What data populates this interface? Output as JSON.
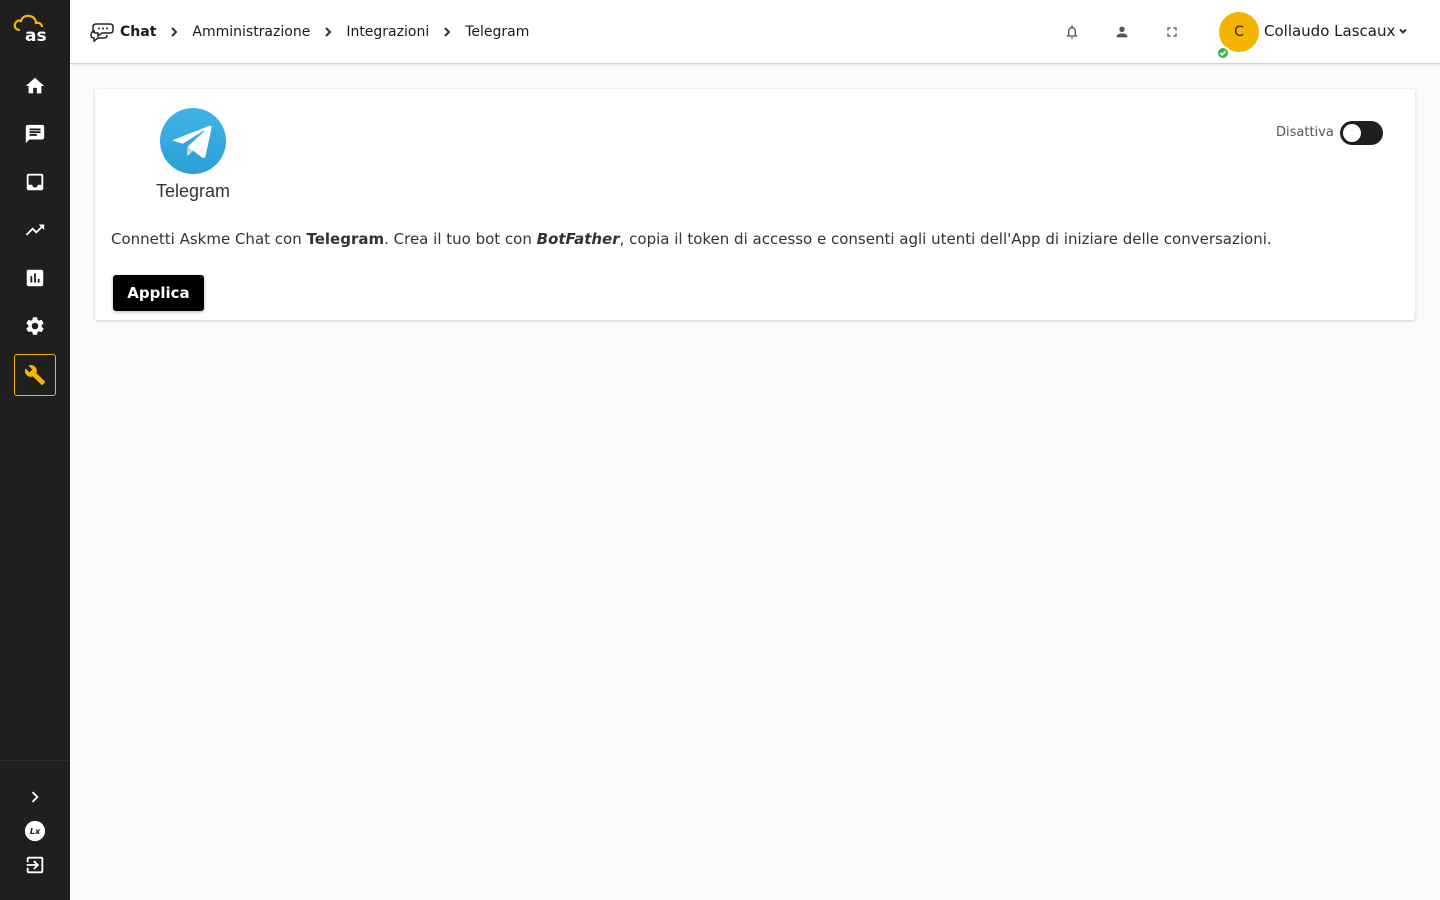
{
  "sidebar": {
    "items": [
      {
        "name": "home-icon"
      },
      {
        "name": "chat-icon"
      },
      {
        "name": "inbox-icon"
      },
      {
        "name": "trending-icon"
      },
      {
        "name": "bar-chart-icon"
      },
      {
        "name": "gear-icon"
      },
      {
        "name": "wrench-icon",
        "active": true
      }
    ],
    "bottom": [
      "chevron-right-icon",
      "lx-icon",
      "logout-icon"
    ],
    "accent_color": "#f5b400",
    "background_color": "#1f1f1f"
  },
  "header": {
    "breadcrumb": [
      "Chat",
      "Amministrazione",
      "Integrazioni",
      "Telegram"
    ],
    "icons": [
      "bell-icon",
      "person-icon",
      "fullscreen-icon"
    ],
    "user": {
      "initial": "C",
      "name": "Collaudo Lascaux",
      "status": "online"
    }
  },
  "card": {
    "title": "Telegram",
    "toggle_label": "Disattiva",
    "description": {
      "part1": "Connetti Askme Chat con ",
      "brand": "Telegram",
      "part2": ". Crea il tuo bot con ",
      "bot": "BotFather",
      "part3": ", copia il token di accesso e consenti agli utenti dell'App di iniziare delle conversazioni."
    },
    "apply_label": "Applica",
    "brand_color": "#37aee2"
  }
}
